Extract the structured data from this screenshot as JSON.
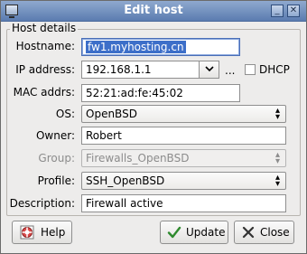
{
  "window": {
    "title": "Edit host",
    "minimize_label": "_",
    "close_label": "✕"
  },
  "group": {
    "label": "Host details"
  },
  "form": {
    "hostname": {
      "label": "Hostname:",
      "value": "fw1.myhosting.cn"
    },
    "ip": {
      "label": "IP address:",
      "value": "192.168.1.1",
      "extra": "..."
    },
    "dhcp": {
      "label": "DHCP",
      "checked": false
    },
    "mac": {
      "label": "MAC addrs:",
      "value": "52:21:ad:fe:45:02"
    },
    "os": {
      "label": "OS:",
      "value": "OpenBSD"
    },
    "owner": {
      "label": "Owner:",
      "value": "Robert"
    },
    "group": {
      "label": "Group:",
      "value": "Firewalls_OpenBSD"
    },
    "profile": {
      "label": "Profile:",
      "value": "SSH_OpenBSD"
    },
    "description": {
      "label": "Description:",
      "value": "Firewall active"
    }
  },
  "buttons": {
    "help": "Help",
    "update": "Update",
    "close": "Close"
  },
  "icons": {
    "app": "app-window-icon",
    "help": "help-lifebuoy-icon",
    "update": "checkmark-icon",
    "close": "close-x-icon"
  }
}
